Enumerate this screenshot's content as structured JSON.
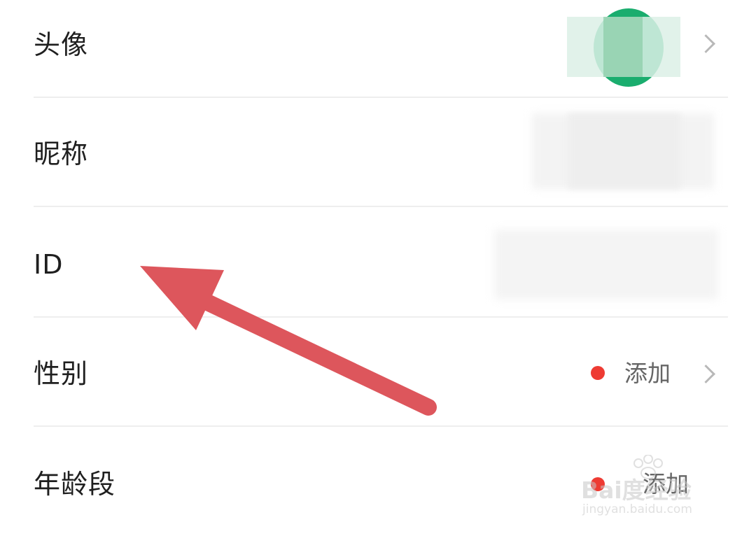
{
  "rows": [
    {
      "label": "头像"
    },
    {
      "label": "昵称"
    },
    {
      "label": "ID"
    },
    {
      "label": "性别",
      "value": "添加"
    },
    {
      "label": "年龄段",
      "value": "添加"
    }
  ],
  "watermark": {
    "brand": "Bai度经验",
    "url": "jingyan.baidu.com"
  },
  "colors": {
    "accent_dot": "#ee3b33",
    "arrow": "#dd565c",
    "avatar": "#1aad6e"
  },
  "icons": [
    "chevron-right-icon",
    "red-dot-icon",
    "arrow-annotation",
    "baidu-paw-icon"
  ]
}
